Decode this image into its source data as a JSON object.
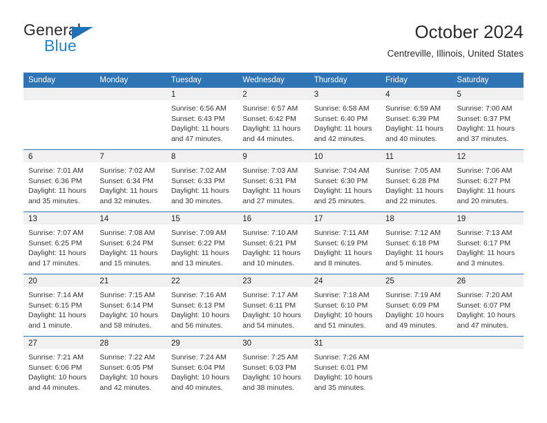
{
  "brand": {
    "name_top": "General",
    "name_bottom": "Blue",
    "triangle_color": "#1f72b8",
    "blue_color": "#1f84d6"
  },
  "header": {
    "title": "October 2024",
    "subtitle": "Centreville, Illinois, United States"
  },
  "theme": {
    "header_blue": "#2f74b5",
    "daynum_gray": "#f0f0f0"
  },
  "calendar": {
    "weekday_headers": [
      "Sunday",
      "Monday",
      "Tuesday",
      "Wednesday",
      "Thursday",
      "Friday",
      "Saturday"
    ],
    "weeks": [
      [
        {
          "day": "",
          "blank": true
        },
        {
          "day": "",
          "blank": true
        },
        {
          "day": "1",
          "sunrise": "Sunrise: 6:56 AM",
          "sunset": "Sunset: 6:43 PM",
          "daylight_line1": "Daylight: 11 hours",
          "daylight_line2": "and 47 minutes."
        },
        {
          "day": "2",
          "sunrise": "Sunrise: 6:57 AM",
          "sunset": "Sunset: 6:42 PM",
          "daylight_line1": "Daylight: 11 hours",
          "daylight_line2": "and 44 minutes."
        },
        {
          "day": "3",
          "sunrise": "Sunrise: 6:58 AM",
          "sunset": "Sunset: 6:40 PM",
          "daylight_line1": "Daylight: 11 hours",
          "daylight_line2": "and 42 minutes."
        },
        {
          "day": "4",
          "sunrise": "Sunrise: 6:59 AM",
          "sunset": "Sunset: 6:39 PM",
          "daylight_line1": "Daylight: 11 hours",
          "daylight_line2": "and 40 minutes."
        },
        {
          "day": "5",
          "sunrise": "Sunrise: 7:00 AM",
          "sunset": "Sunset: 6:37 PM",
          "daylight_line1": "Daylight: 11 hours",
          "daylight_line2": "and 37 minutes."
        }
      ],
      [
        {
          "day": "6",
          "sunrise": "Sunrise: 7:01 AM",
          "sunset": "Sunset: 6:36 PM",
          "daylight_line1": "Daylight: 11 hours",
          "daylight_line2": "and 35 minutes."
        },
        {
          "day": "7",
          "sunrise": "Sunrise: 7:02 AM",
          "sunset": "Sunset: 6:34 PM",
          "daylight_line1": "Daylight: 11 hours",
          "daylight_line2": "and 32 minutes."
        },
        {
          "day": "8",
          "sunrise": "Sunrise: 7:02 AM",
          "sunset": "Sunset: 6:33 PM",
          "daylight_line1": "Daylight: 11 hours",
          "daylight_line2": "and 30 minutes."
        },
        {
          "day": "9",
          "sunrise": "Sunrise: 7:03 AM",
          "sunset": "Sunset: 6:31 PM",
          "daylight_line1": "Daylight: 11 hours",
          "daylight_line2": "and 27 minutes."
        },
        {
          "day": "10",
          "sunrise": "Sunrise: 7:04 AM",
          "sunset": "Sunset: 6:30 PM",
          "daylight_line1": "Daylight: 11 hours",
          "daylight_line2": "and 25 minutes."
        },
        {
          "day": "11",
          "sunrise": "Sunrise: 7:05 AM",
          "sunset": "Sunset: 6:28 PM",
          "daylight_line1": "Daylight: 11 hours",
          "daylight_line2": "and 22 minutes."
        },
        {
          "day": "12",
          "sunrise": "Sunrise: 7:06 AM",
          "sunset": "Sunset: 6:27 PM",
          "daylight_line1": "Daylight: 11 hours",
          "daylight_line2": "and 20 minutes."
        }
      ],
      [
        {
          "day": "13",
          "sunrise": "Sunrise: 7:07 AM",
          "sunset": "Sunset: 6:25 PM",
          "daylight_line1": "Daylight: 11 hours",
          "daylight_line2": "and 17 minutes."
        },
        {
          "day": "14",
          "sunrise": "Sunrise: 7:08 AM",
          "sunset": "Sunset: 6:24 PM",
          "daylight_line1": "Daylight: 11 hours",
          "daylight_line2": "and 15 minutes."
        },
        {
          "day": "15",
          "sunrise": "Sunrise: 7:09 AM",
          "sunset": "Sunset: 6:22 PM",
          "daylight_line1": "Daylight: 11 hours",
          "daylight_line2": "and 13 minutes."
        },
        {
          "day": "16",
          "sunrise": "Sunrise: 7:10 AM",
          "sunset": "Sunset: 6:21 PM",
          "daylight_line1": "Daylight: 11 hours",
          "daylight_line2": "and 10 minutes."
        },
        {
          "day": "17",
          "sunrise": "Sunrise: 7:11 AM",
          "sunset": "Sunset: 6:19 PM",
          "daylight_line1": "Daylight: 11 hours",
          "daylight_line2": "and 8 minutes."
        },
        {
          "day": "18",
          "sunrise": "Sunrise: 7:12 AM",
          "sunset": "Sunset: 6:18 PM",
          "daylight_line1": "Daylight: 11 hours",
          "daylight_line2": "and 5 minutes."
        },
        {
          "day": "19",
          "sunrise": "Sunrise: 7:13 AM",
          "sunset": "Sunset: 6:17 PM",
          "daylight_line1": "Daylight: 11 hours",
          "daylight_line2": "and 3 minutes."
        }
      ],
      [
        {
          "day": "20",
          "sunrise": "Sunrise: 7:14 AM",
          "sunset": "Sunset: 6:15 PM",
          "daylight_line1": "Daylight: 11 hours",
          "daylight_line2": "and 1 minute."
        },
        {
          "day": "21",
          "sunrise": "Sunrise: 7:15 AM",
          "sunset": "Sunset: 6:14 PM",
          "daylight_line1": "Daylight: 10 hours",
          "daylight_line2": "and 58 minutes."
        },
        {
          "day": "22",
          "sunrise": "Sunrise: 7:16 AM",
          "sunset": "Sunset: 6:13 PM",
          "daylight_line1": "Daylight: 10 hours",
          "daylight_line2": "and 56 minutes."
        },
        {
          "day": "23",
          "sunrise": "Sunrise: 7:17 AM",
          "sunset": "Sunset: 6:11 PM",
          "daylight_line1": "Daylight: 10 hours",
          "daylight_line2": "and 54 minutes."
        },
        {
          "day": "24",
          "sunrise": "Sunrise: 7:18 AM",
          "sunset": "Sunset: 6:10 PM",
          "daylight_line1": "Daylight: 10 hours",
          "daylight_line2": "and 51 minutes."
        },
        {
          "day": "25",
          "sunrise": "Sunrise: 7:19 AM",
          "sunset": "Sunset: 6:09 PM",
          "daylight_line1": "Daylight: 10 hours",
          "daylight_line2": "and 49 minutes."
        },
        {
          "day": "26",
          "sunrise": "Sunrise: 7:20 AM",
          "sunset": "Sunset: 6:07 PM",
          "daylight_line1": "Daylight: 10 hours",
          "daylight_line2": "and 47 minutes."
        }
      ],
      [
        {
          "day": "27",
          "sunrise": "Sunrise: 7:21 AM",
          "sunset": "Sunset: 6:06 PM",
          "daylight_line1": "Daylight: 10 hours",
          "daylight_line2": "and 44 minutes."
        },
        {
          "day": "28",
          "sunrise": "Sunrise: 7:22 AM",
          "sunset": "Sunset: 6:05 PM",
          "daylight_line1": "Daylight: 10 hours",
          "daylight_line2": "and 42 minutes."
        },
        {
          "day": "29",
          "sunrise": "Sunrise: 7:24 AM",
          "sunset": "Sunset: 6:04 PM",
          "daylight_line1": "Daylight: 10 hours",
          "daylight_line2": "and 40 minutes."
        },
        {
          "day": "30",
          "sunrise": "Sunrise: 7:25 AM",
          "sunset": "Sunset: 6:03 PM",
          "daylight_line1": "Daylight: 10 hours",
          "daylight_line2": "and 38 minutes."
        },
        {
          "day": "31",
          "sunrise": "Sunrise: 7:26 AM",
          "sunset": "Sunset: 6:01 PM",
          "daylight_line1": "Daylight: 10 hours",
          "daylight_line2": "and 35 minutes."
        },
        {
          "day": "",
          "blank": true
        },
        {
          "day": "",
          "blank": true
        }
      ]
    ]
  }
}
